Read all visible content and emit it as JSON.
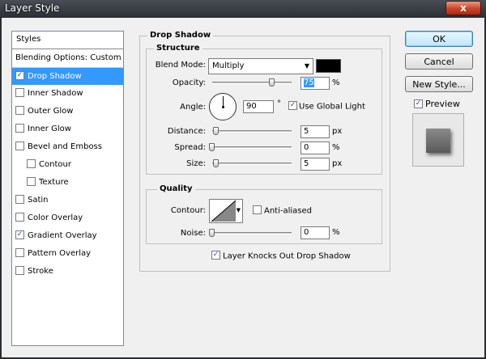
{
  "window": {
    "title": "Layer Style",
    "close_glyph": "x"
  },
  "styles_panel": {
    "header": "Styles",
    "items": [
      {
        "label": "Blending Options: Custom",
        "checkbox": false
      },
      {
        "label": "Drop Shadow",
        "checkbox": true,
        "checked": true,
        "selected": true
      },
      {
        "label": "Inner Shadow",
        "checkbox": true,
        "checked": false
      },
      {
        "label": "Outer Glow",
        "checkbox": true,
        "checked": false
      },
      {
        "label": "Inner Glow",
        "checkbox": true,
        "checked": false
      },
      {
        "label": "Bevel and Emboss",
        "checkbox": true,
        "checked": false
      },
      {
        "label": "Contour",
        "checkbox": true,
        "checked": false,
        "indent": true
      },
      {
        "label": "Texture",
        "checkbox": true,
        "checked": false,
        "indent": true
      },
      {
        "label": "Satin",
        "checkbox": true,
        "checked": false
      },
      {
        "label": "Color Overlay",
        "checkbox": true,
        "checked": false
      },
      {
        "label": "Gradient Overlay",
        "checkbox": true,
        "checked": true
      },
      {
        "label": "Pattern Overlay",
        "checkbox": true,
        "checked": false
      },
      {
        "label": "Stroke",
        "checkbox": true,
        "checked": false
      }
    ]
  },
  "drop_shadow": {
    "title": "Drop Shadow",
    "structure": {
      "title": "Structure",
      "blend_mode_label": "Blend Mode:",
      "blend_mode_value": "Multiply",
      "shadow_color": "#000000",
      "opacity_label": "Opacity:",
      "opacity_value": "75",
      "opacity_unit": "%",
      "angle_label": "Angle:",
      "angle_value": "90",
      "angle_unit": "°",
      "use_global_light_label": "Use Global Light",
      "use_global_light_checked": true,
      "distance_label": "Distance:",
      "distance_value": "5",
      "distance_unit": "px",
      "spread_label": "Spread:",
      "spread_value": "0",
      "spread_unit": "%",
      "size_label": "Size:",
      "size_value": "5",
      "size_unit": "px"
    },
    "quality": {
      "title": "Quality",
      "contour_label": "Contour:",
      "anti_aliased_label": "Anti-aliased",
      "anti_aliased_checked": false,
      "noise_label": "Noise:",
      "noise_value": "0",
      "noise_unit": "%"
    },
    "knockout_label": "Layer Knocks Out Drop Shadow",
    "knockout_checked": true
  },
  "buttons": {
    "ok": "OK",
    "cancel": "Cancel",
    "new_style": "New Style...",
    "preview_label": "Preview",
    "preview_checked": true
  }
}
